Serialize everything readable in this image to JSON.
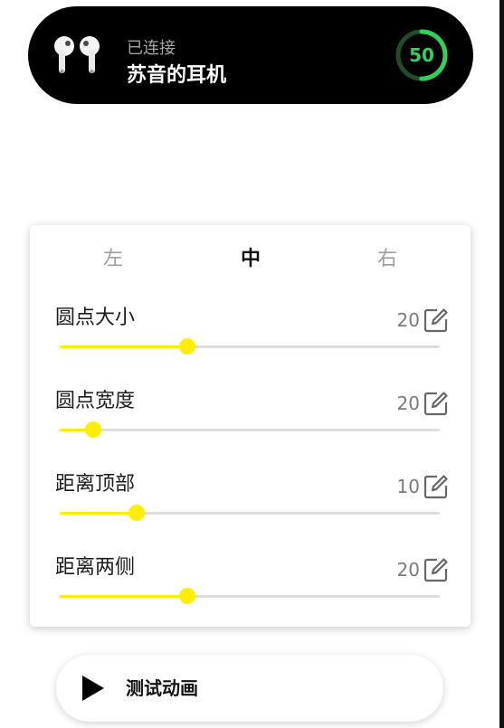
{
  "header": {
    "status": "已连接",
    "device_name": "苏音的耳机",
    "battery_percent": 50,
    "battery_label": "50",
    "icon": "earbuds-icon",
    "battery_color": "#30d158"
  },
  "position_tabs": {
    "items": [
      {
        "label": "左"
      },
      {
        "label": "中"
      },
      {
        "label": "右"
      }
    ],
    "active_index": 1
  },
  "settings": [
    {
      "label": "圆点大小",
      "value": "20",
      "slider_fraction": 0.335,
      "edit_icon": "edit-icon"
    },
    {
      "label": "圆点宽度",
      "value": "20",
      "slider_fraction": 0.088,
      "edit_icon": "edit-icon"
    },
    {
      "label": "距离顶部",
      "value": "10",
      "slider_fraction": 0.202,
      "edit_icon": "edit-icon"
    },
    {
      "label": "距离两侧",
      "value": "20",
      "slider_fraction": 0.335,
      "edit_icon": "edit-icon"
    }
  ],
  "slider_color": "#ffee00",
  "test_button": {
    "label": "测试动画",
    "icon": "play-icon"
  }
}
